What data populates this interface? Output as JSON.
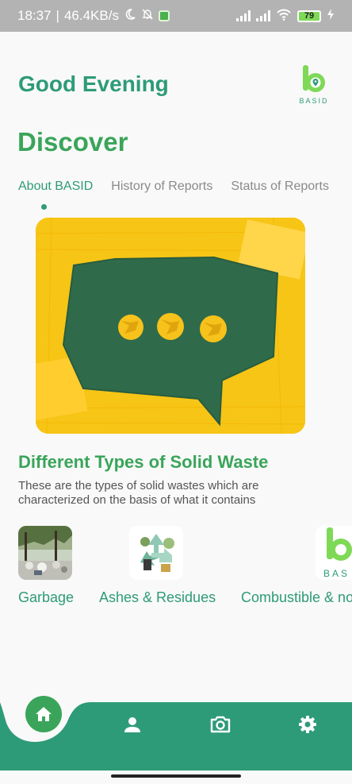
{
  "status_bar": {
    "time": "18:37",
    "speed": "46.4KB/s",
    "battery": "79",
    "icons": [
      "moon-icon",
      "bell-off-icon",
      "app-notification-icon",
      "signal-icon",
      "signal-icon",
      "wifi-icon",
      "battery-icon",
      "charging-icon"
    ]
  },
  "header": {
    "greeting": "Good Evening",
    "logo_text": "BASID"
  },
  "page_title": "Discover",
  "tabs": [
    {
      "label": "About BASID",
      "active": true
    },
    {
      "label": "History of Reports",
      "active": false
    },
    {
      "label": "Status of Reports",
      "active": false
    }
  ],
  "section": {
    "title": "Different Types of Solid Waste",
    "description": "These are the types of solid wastes which are characterized on the basis of what it contains"
  },
  "categories": [
    {
      "label": "Garbage",
      "image": "garbage-photo"
    },
    {
      "label": "Ashes & Residues",
      "image": "recycle-illustration"
    },
    {
      "label": "Combustible & no",
      "image": "basid-logo"
    }
  ],
  "bottom_nav": {
    "items": [
      "home-icon",
      "profile-icon",
      "camera-icon",
      "settings-icon"
    ],
    "active": "home-icon"
  },
  "colors": {
    "primary": "#2e9b78",
    "accent_green": "#3aa55a",
    "nav_bg": "#2e9b78",
    "hero_yellow": "#f7c516",
    "hero_green": "#2f6b4a"
  }
}
